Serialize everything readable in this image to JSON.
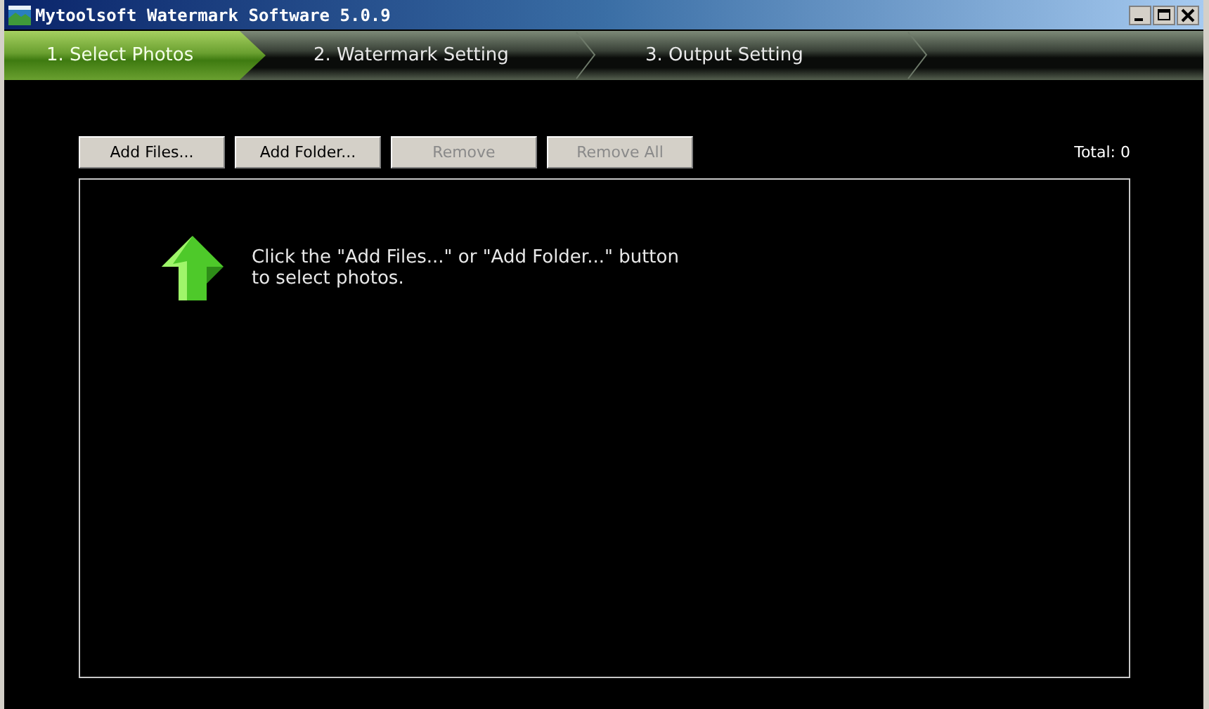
{
  "window": {
    "title": "Mytoolsoft Watermark Software 5.0.9"
  },
  "tabs": [
    {
      "label": "1. Select Photos",
      "selected": true
    },
    {
      "label": "2. Watermark Setting",
      "selected": false
    },
    {
      "label": "3. Output Setting",
      "selected": false
    }
  ],
  "toolbar": {
    "buttons": [
      {
        "label": "Add Files...",
        "disabled": false
      },
      {
        "label": "Add Folder...",
        "disabled": false
      },
      {
        "label": "Remove",
        "disabled": true
      },
      {
        "label": "Remove All",
        "disabled": true
      }
    ],
    "total": "Total: 0"
  },
  "photo_list": {
    "hint": "Click the \"Add Files...\" or \"Add Folder...\" button to select photos."
  }
}
